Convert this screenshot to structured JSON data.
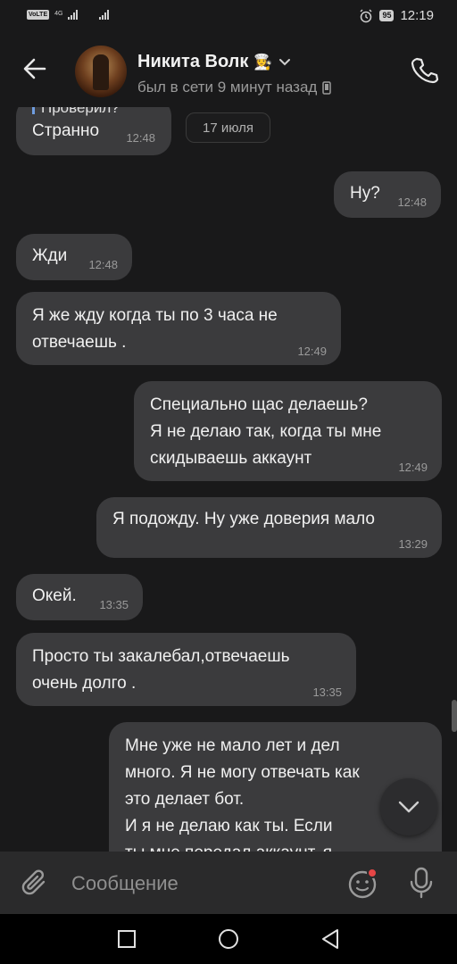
{
  "status_bar": {
    "carrier": "VoLTE",
    "network": "4G",
    "battery": "95",
    "time": "12:19"
  },
  "header": {
    "contact_name": "Никита Волк",
    "contact_emoji": "👩‍🍳",
    "status": "был в сети 9 минут назад"
  },
  "chat": {
    "quote_preview": "Проверил?",
    "date_chip": "17 июля",
    "messages": [
      {
        "text": "Странно",
        "time": "12:48",
        "side": "in"
      },
      {
        "text": "Ну?",
        "time": "12:48",
        "side": "out"
      },
      {
        "text": "Жди",
        "time": "12:48",
        "side": "in"
      },
      {
        "text": "Я же жду когда ты по 3 часа не\nотвечаешь .",
        "time": "12:49",
        "side": "in"
      },
      {
        "text": "Специально щас делаешь?\nЯ не делаю так, когда ты мне\nскидываешь аккаунт",
        "time": "12:49",
        "side": "out"
      },
      {
        "text": "Я подожду. Ну уже доверия мало",
        "time": "13:29",
        "side": "out"
      },
      {
        "text": "Окей.",
        "time": "13:35",
        "side": "in"
      },
      {
        "text": "Просто ты закалебал,отвечаешь\nочень долго .",
        "time": "13:35",
        "side": "in"
      },
      {
        "text": "Мне уже не мало лет и  дел\nмного. Я не могу отвечать как\nэто делает бот.\nИ я не делаю как ты. Если\nты мне передал аккаунт, я",
        "time": "",
        "side": "out"
      }
    ]
  },
  "composer": {
    "placeholder": "Сообщение"
  },
  "icons": {
    "back": "arrow-left-icon",
    "call": "phone-icon",
    "attach": "paperclip-icon",
    "emoji": "smile-icon",
    "voice": "microphone-icon",
    "scroll_down": "chevron-down-icon"
  },
  "colors": {
    "background": "#19191a",
    "bubble": "#3b3b3d",
    "notification_dot": "#e64646",
    "quote_accent": "#6f9de0"
  }
}
